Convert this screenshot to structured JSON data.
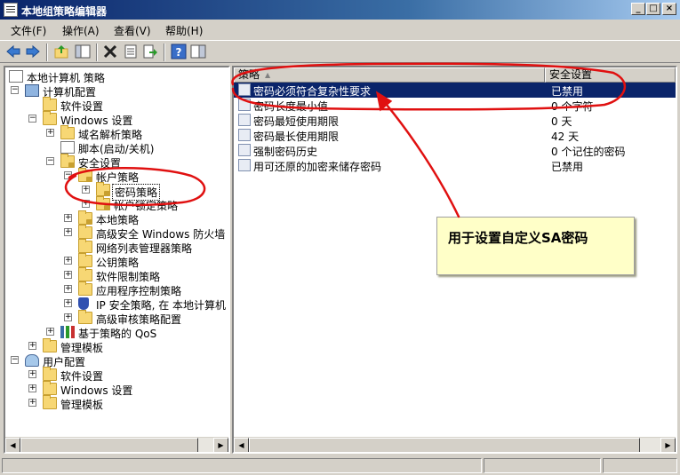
{
  "window": {
    "title": "本地组策略编辑器",
    "controls": [
      "_",
      "□",
      "×"
    ]
  },
  "menu": [
    "文件(F)",
    "操作(A)",
    "查看(V)",
    "帮助(H)"
  ],
  "toolbar_icons": [
    "back-icon",
    "forward-icon",
    "up-folder-icon",
    "show-hide-tree-icon",
    "delete-icon",
    "properties-icon",
    "export-icon",
    "help-icon",
    "show-scope-icon"
  ],
  "tree": {
    "root": "本地计算机 策略",
    "computer_config": "计算机配置",
    "software_settings": "软件设置",
    "windows_settings": "Windows 设置",
    "name_resolution": "域名解析策略",
    "scripts": "脚本(启动/关机)",
    "security_settings": "安全设置",
    "account_policies": "帐户策略",
    "password_policy": "密码策略",
    "account_lockout": "帐户锁定策略",
    "local_policies": "本地策略",
    "firewall": "高级安全 Windows 防火墙",
    "network_list": "网络列表管理器策略",
    "public_key": "公钥策略",
    "software_restriction": "软件限制策略",
    "app_control": "应用程序控制策略",
    "ip_security": "IP 安全策略, 在 本地计算机",
    "advanced_audit": "高级审核策略配置",
    "qos": "基于策略的 QoS",
    "admin_templates": "管理模板",
    "user_config": "用户配置",
    "user_software": "软件设置",
    "user_windows": "Windows 设置",
    "user_admin_templates": "管理模板"
  },
  "list": {
    "headers": [
      "策略",
      "安全设置"
    ],
    "rows": [
      {
        "policy": "密码必须符合复杂性要求",
        "setting": "已禁用"
      },
      {
        "policy": "密码长度最小值",
        "setting": "0 个字符"
      },
      {
        "policy": "密码最短使用期限",
        "setting": "0 天"
      },
      {
        "policy": "密码最长使用期限",
        "setting": "42 天"
      },
      {
        "policy": "强制密码历史",
        "setting": "0 个记住的密码"
      },
      {
        "policy": "用可还原的加密来储存密码",
        "setting": "已禁用"
      }
    ]
  },
  "annotation": {
    "note": "用于设置自定义SA密码",
    "color": "#e01010"
  },
  "colors": {
    "title_gradient_start": "#0a246a",
    "selection": "#0a246a",
    "chrome": "#d4d0c8",
    "note_bg": "#ffffc8"
  }
}
